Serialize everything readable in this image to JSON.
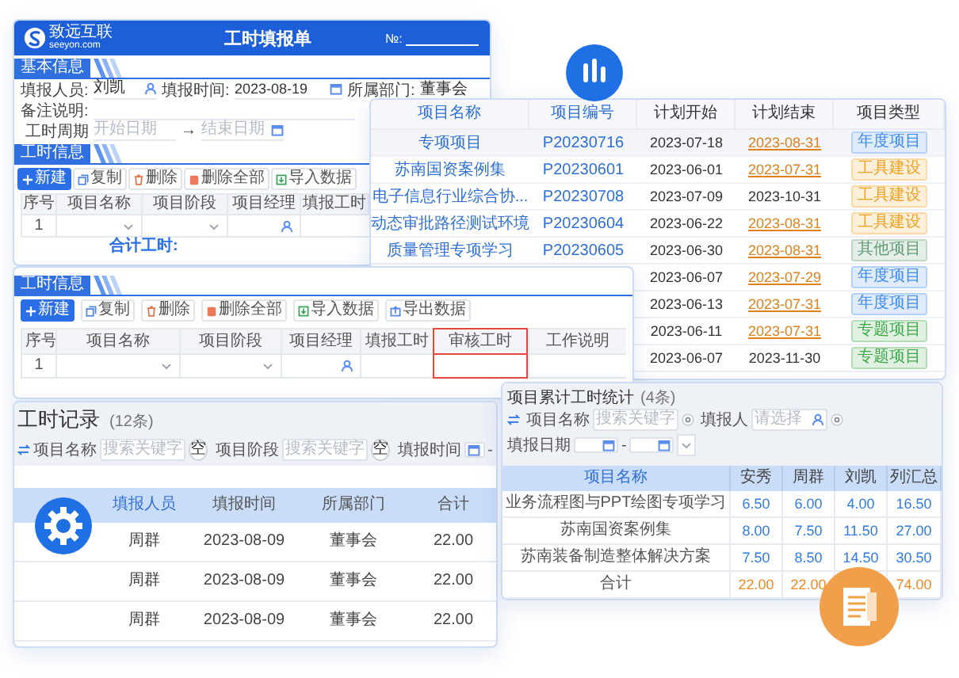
{
  "form_window": {
    "logo_text": "致远互联",
    "logo_subtext": "seeyon.com",
    "title": "工时填报单",
    "number_label": "№:",
    "basic_section": "基本信息",
    "fields": [
      {
        "label": "填报人员:",
        "value": "刘凯",
        "kind": "person"
      },
      {
        "label": "填报时间:",
        "value": "2023-08-19",
        "kind": "date"
      },
      {
        "label": "所属部门:",
        "value": "董事会",
        "kind": "text"
      }
    ],
    "remark_label": "备注说明:",
    "period": {
      "label": "工时周期",
      "start_placeholder": "开始日期",
      "arrow": "→",
      "end_placeholder": "结束日期"
    },
    "hours_section": "工时信息",
    "toolbar": [
      {
        "label": "新建",
        "kind": "primary"
      },
      {
        "label": "复制",
        "kind": "copy"
      },
      {
        "label": "删除",
        "kind": "delete"
      },
      {
        "label": "删除全部",
        "kind": "delete_all"
      },
      {
        "label": "导入数据",
        "kind": "import"
      }
    ],
    "columns": [
      "序号",
      "项目名称",
      "项目阶段",
      "项目经理",
      "填报工时"
    ],
    "rows": [
      {
        "index": "1"
      }
    ],
    "total_label": "合计工时:"
  },
  "hours_window": {
    "section": "工时信息",
    "toolbar": [
      {
        "label": "新建",
        "kind": "primary"
      },
      {
        "label": "复制",
        "kind": "copy"
      },
      {
        "label": "删除",
        "kind": "delete"
      },
      {
        "label": "删除全部",
        "kind": "delete_all"
      },
      {
        "label": "导入数据",
        "kind": "import"
      },
      {
        "label": "导出数据",
        "kind": "export"
      }
    ],
    "columns": [
      {
        "label": "序号",
        "highlighted": false
      },
      {
        "label": "项目名称",
        "highlighted": false
      },
      {
        "label": "项目阶段",
        "highlighted": false
      },
      {
        "label": "项目经理",
        "highlighted": false
      },
      {
        "label": "填报工时",
        "highlighted": false
      },
      {
        "label": "审核工时",
        "highlighted": true
      },
      {
        "label": "工作说明",
        "highlighted": false
      }
    ],
    "rows": [
      {
        "index": "1"
      }
    ]
  },
  "project_table": {
    "columns": [
      "项目名称",
      "项目编号",
      "计划开始",
      "计划结束",
      "项目类型"
    ],
    "rows": [
      {
        "name": "专项项目",
        "code": "P20230716",
        "start": "2023-07-18",
        "end": "2023-08-31",
        "overdue": true,
        "type": "年度项目",
        "color": "#3d8bf0",
        "selected": true
      },
      {
        "name": "苏南国资案例集",
        "code": "P20230601",
        "start": "2023-06-01",
        "end": "2023-07-31",
        "overdue": true,
        "type": "工具建设",
        "color": "#f0a020",
        "selected": false
      },
      {
        "name": "电子信息行业综合协...",
        "code": "P20230708",
        "start": "2023-07-09",
        "end": "2023-10-31",
        "overdue": false,
        "type": "工具建设",
        "color": "#f0a020",
        "selected": false
      },
      {
        "name": "动态审批路径测试环境",
        "code": "P20230604",
        "start": "2023-06-22",
        "end": "2023-08-31",
        "overdue": true,
        "type": "工具建设",
        "color": "#f0a020",
        "selected": false
      },
      {
        "name": "质量管理专项学习",
        "code": "P20230605",
        "start": "2023-06-30",
        "end": "2023-08-31",
        "overdue": true,
        "type": "其他项目",
        "color": "#5c9a72",
        "selected": false
      },
      {
        "start": "2023-06-07",
        "end": "2023-07-29",
        "overdue": true,
        "type": "年度项目",
        "color": "#3d8bf0",
        "selected": false
      },
      {
        "start": "2023-06-13",
        "end": "2023-07-31",
        "overdue": true,
        "type": "年度项目",
        "color": "#3d8bf0",
        "selected": false
      },
      {
        "start": "2023-06-11",
        "end": "2023-07-31",
        "overdue": true,
        "type": "专题项目",
        "color": "#3fa84a",
        "selected": false
      },
      {
        "start": "2023-06-07",
        "end": "2023-11-30",
        "overdue": false,
        "type": "专题项目",
        "color": "#3fa84a",
        "selected": false
      }
    ]
  },
  "work_records": {
    "title": "工时记录",
    "count": "(12条)",
    "filters": [
      {
        "label": "项目名称",
        "placeholder": "搜索关键字",
        "clear": "空",
        "kind": "search"
      },
      {
        "label": "项目阶段",
        "placeholder": "搜索关键字",
        "clear": "空",
        "kind": "search"
      },
      {
        "label": "填报时间",
        "separator": "-",
        "kind": "date"
      }
    ],
    "columns": [
      "填报人员",
      "填报时间",
      "所属部门",
      "合计"
    ],
    "rows": [
      {
        "person": "周群",
        "date": "2023-08-09",
        "dept": "董事会",
        "total": "22.00"
      },
      {
        "person": "周群",
        "date": "2023-08-09",
        "dept": "董事会",
        "total": "22.00"
      },
      {
        "person": "周群",
        "date": "2023-08-09",
        "dept": "董事会",
        "total": "22.00"
      }
    ]
  },
  "project_stats": {
    "title": "项目累计工时统计",
    "count": "(4条)",
    "filters": [
      {
        "label": "项目名称",
        "placeholder": "搜索关键字",
        "kind": "search"
      },
      {
        "label": "填报人",
        "placeholder": "请选择",
        "kind": "person"
      },
      {
        "label": "填报日期",
        "separator": "-",
        "kind": "date_range"
      }
    ],
    "columns": [
      "项目名称",
      "安秀",
      "周群",
      "刘凯",
      "列汇总"
    ],
    "rows": [
      {
        "name": "业务流程图与PPT绘图专项学习",
        "values": [
          "6.50",
          "6.00",
          "4.00"
        ],
        "row_total": "16.50",
        "kind": "item"
      },
      {
        "name": "苏南国资案例集",
        "values": [
          "8.00",
          "7.50",
          "11.50"
        ],
        "row_total": "27.00",
        "kind": "item"
      },
      {
        "name": "苏南装备制造整体解决方案",
        "values": [
          "7.50",
          "8.50",
          "14.50"
        ],
        "row_total": "30.50",
        "kind": "item"
      },
      {
        "name": "合计",
        "values": [
          "22.00",
          "22.00"
        ],
        "row_total": "74.00",
        "kind": "total"
      }
    ]
  }
}
